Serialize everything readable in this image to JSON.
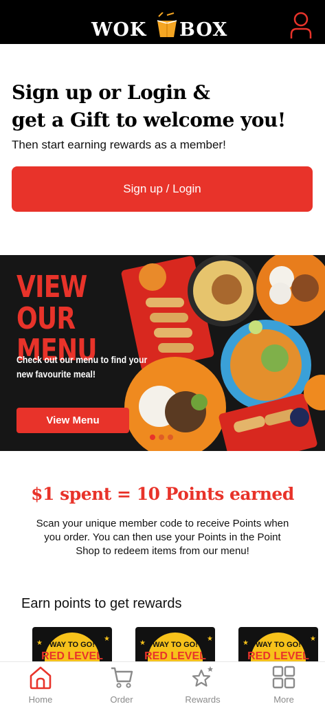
{
  "header": {
    "logo_left": "WOK",
    "logo_right": "BOX"
  },
  "welcome": {
    "title_line1": "Sign up or Login &",
    "title_line2": "get a Gift to welcome you!",
    "subtitle": "Then start earning rewards as a member!",
    "signup_label": "Sign up  / Login"
  },
  "banner": {
    "title": "VIEW OUR MENU",
    "subtitle": "Check out our menu to find your new favourite meal!",
    "button_label": "View Menu",
    "slides": 3,
    "active_slide": 1
  },
  "points": {
    "title": "$1 spent = 10 Points earned",
    "description": "Scan your unique member code to receive Points when you order. You can then use your Points in the Point Shop to redeem items from our menu!"
  },
  "earn": {
    "title": "Earn points to get rewards",
    "cards": [
      {
        "label": "WAY TO GO!",
        "sub": "RED LEVEL"
      },
      {
        "label": "WAY TO GO!",
        "sub": "RED LEVEL"
      },
      {
        "label": "WAY TO GO!",
        "sub": "RED LEVEL"
      }
    ]
  },
  "nav": {
    "items": [
      {
        "label": "Home",
        "icon": "home-icon",
        "active": true
      },
      {
        "label": "Order",
        "icon": "cart-icon",
        "active": false
      },
      {
        "label": "Rewards",
        "icon": "star-icon",
        "active": false
      },
      {
        "label": "More",
        "icon": "grid-icon",
        "active": false
      }
    ]
  },
  "colors": {
    "accent": "#e8332a",
    "header_bg": "#000000",
    "nav_inactive": "#8a8a8a"
  }
}
